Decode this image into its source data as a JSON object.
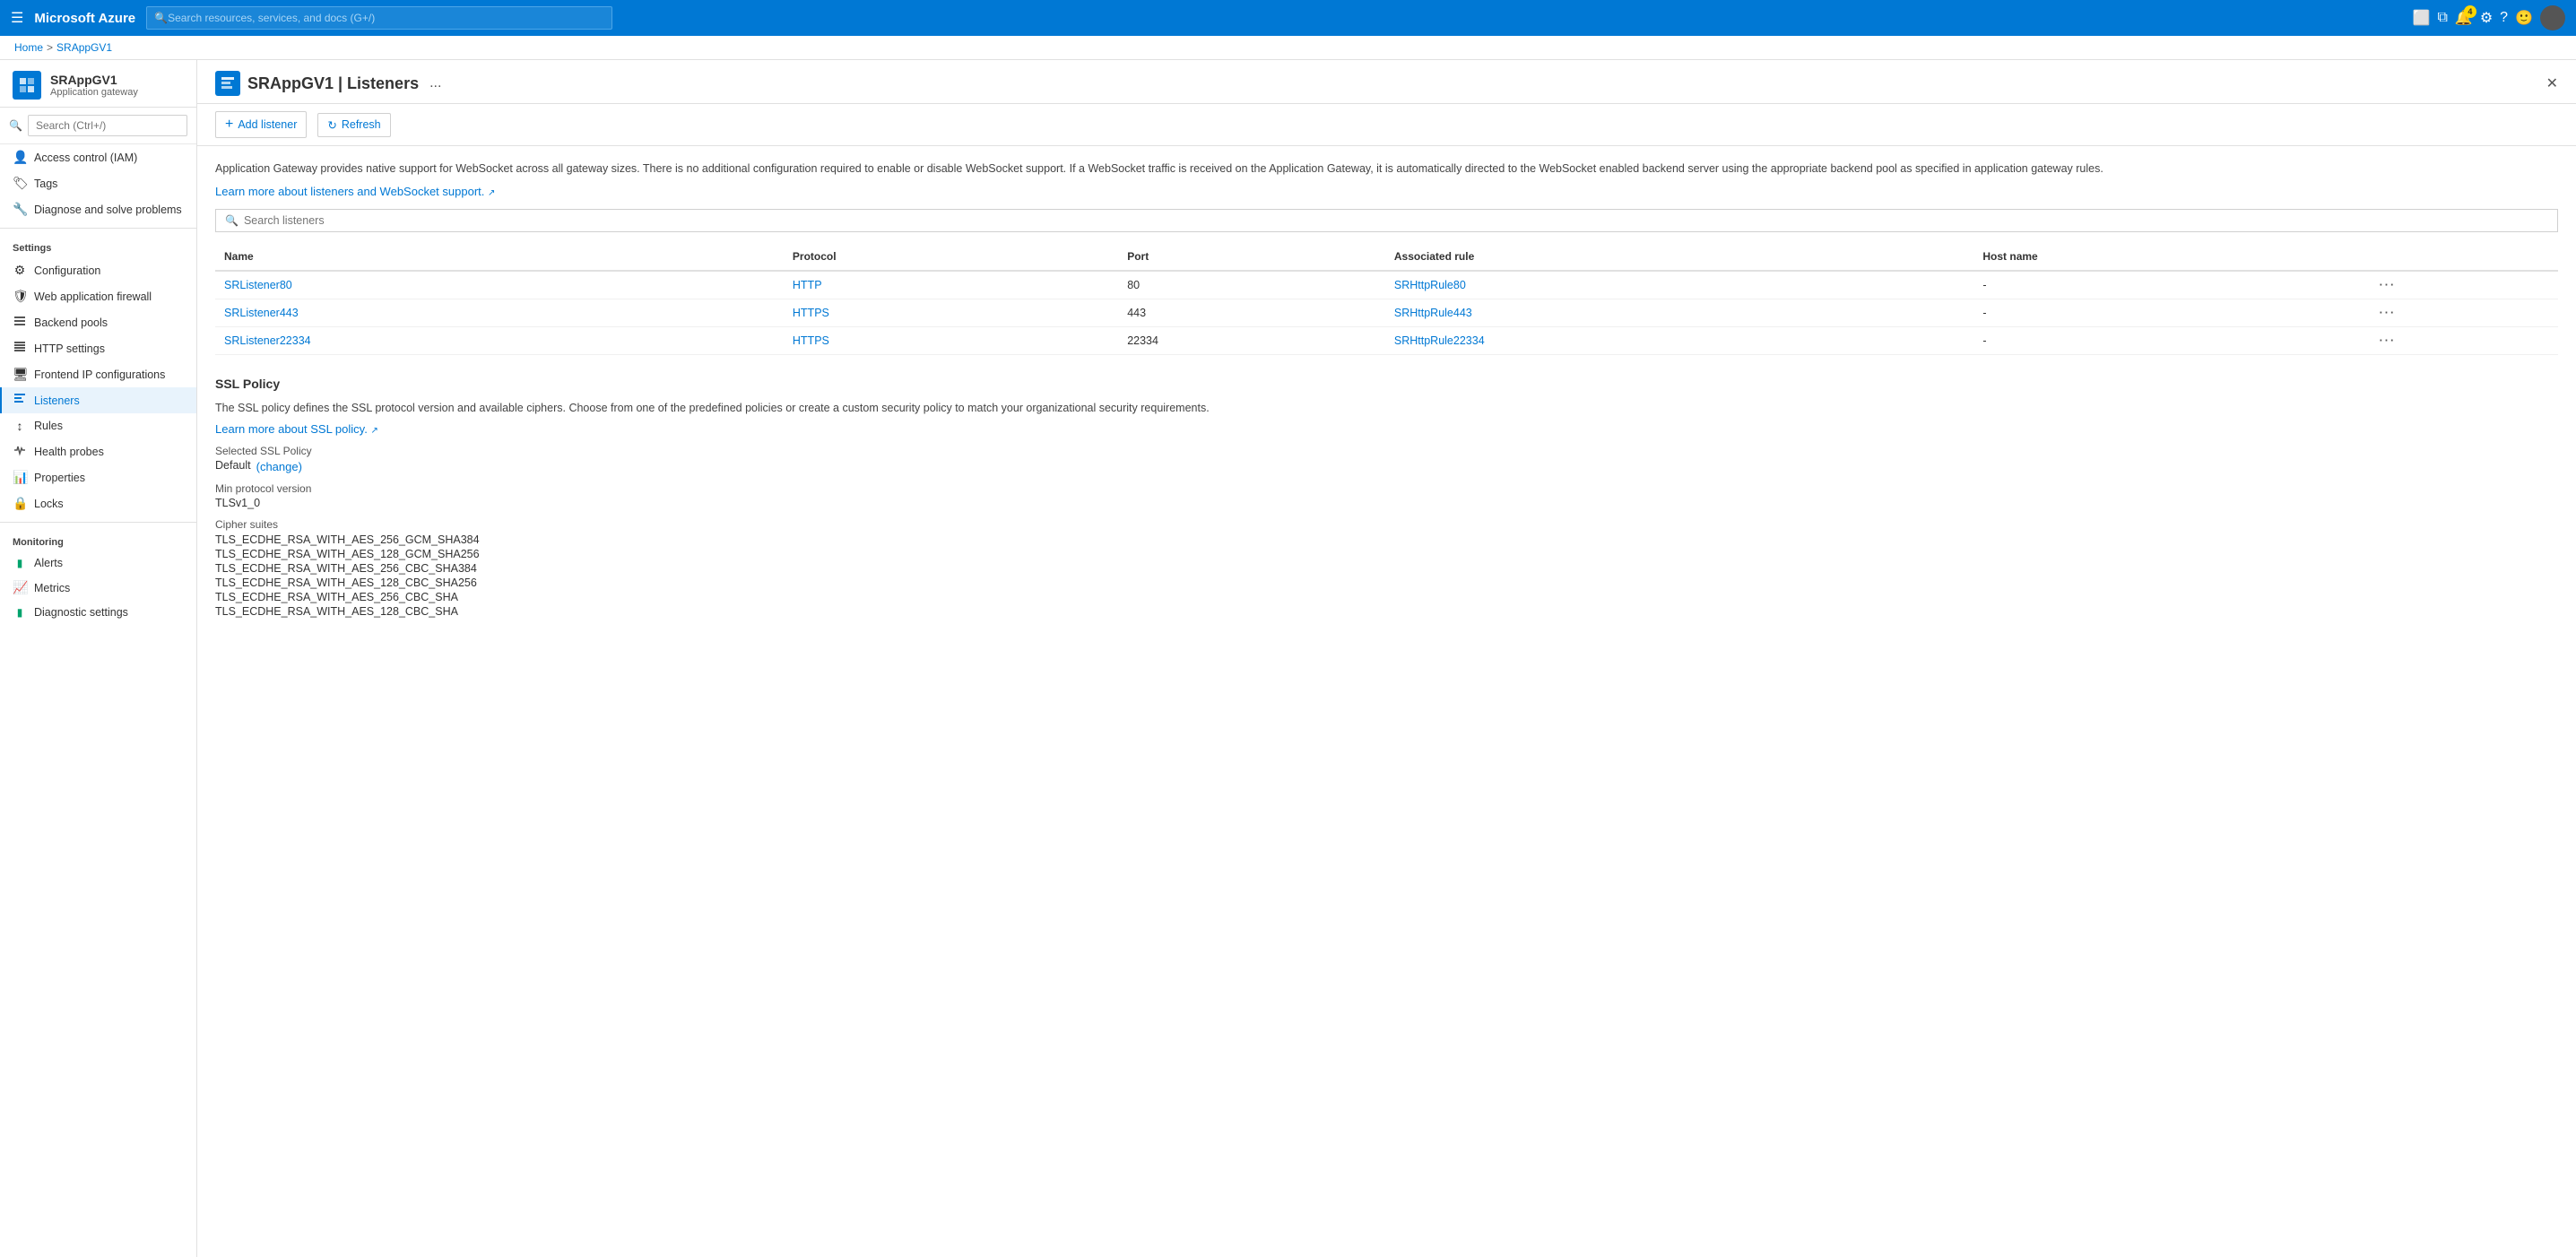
{
  "topbar": {
    "brand": "Microsoft Azure",
    "search_placeholder": "Search resources, services, and docs (G+/)",
    "notification_count": "4"
  },
  "breadcrumb": {
    "home": "Home",
    "resource": "SRAppGV1"
  },
  "sidebar": {
    "resource_title": "SRAppGV1 | Listeners",
    "resource_subtitle": "Application gateway",
    "search_placeholder": "Search (Ctrl+/)",
    "items_top": [
      {
        "id": "access-control",
        "label": "Access control (IAM)",
        "icon": "👤"
      },
      {
        "id": "tags",
        "label": "Tags",
        "icon": "🏷"
      },
      {
        "id": "diagnose",
        "label": "Diagnose and solve problems",
        "icon": "🔧"
      }
    ],
    "settings_label": "Settings",
    "settings_items": [
      {
        "id": "configuration",
        "label": "Configuration",
        "icon": "⚙"
      },
      {
        "id": "waf",
        "label": "Web application firewall",
        "icon": "🛡"
      },
      {
        "id": "backend-pools",
        "label": "Backend pools",
        "icon": "☰"
      },
      {
        "id": "http-settings",
        "label": "HTTP settings",
        "icon": "≡"
      },
      {
        "id": "frontend-ip",
        "label": "Frontend IP configurations",
        "icon": "🖥"
      },
      {
        "id": "listeners",
        "label": "Listeners",
        "icon": "≣",
        "active": true
      },
      {
        "id": "rules",
        "label": "Rules",
        "icon": "↕"
      },
      {
        "id": "health-probes",
        "label": "Health probes",
        "icon": "❤"
      },
      {
        "id": "properties",
        "label": "Properties",
        "icon": "📊"
      },
      {
        "id": "locks",
        "label": "Locks",
        "icon": "🔒"
      }
    ],
    "monitoring_label": "Monitoring",
    "monitoring_items": [
      {
        "id": "alerts",
        "label": "Alerts",
        "icon": "🟩"
      },
      {
        "id": "metrics",
        "label": "Metrics",
        "icon": "📈"
      },
      {
        "id": "diagnostic-settings",
        "label": "Diagnostic settings",
        "icon": "🟩"
      }
    ]
  },
  "page": {
    "title": "SRAppGV1 | Listeners",
    "subtitle": "Application gateway",
    "more_label": "...",
    "toolbar": {
      "add_label": "Add listener",
      "refresh_label": "Refresh"
    },
    "info_text": "Application Gateway provides native support for WebSocket across all gateway sizes. There is no additional configuration required to enable or disable WebSocket support. If a WebSocket traffic is received on the Application Gateway, it is automatically directed to the WebSocket enabled backend server using the appropriate backend pool as specified in application gateway rules.",
    "info_link": "Learn more about listeners and WebSocket support.",
    "search_placeholder": "Search listeners",
    "table": {
      "columns": [
        "Name",
        "Protocol",
        "Port",
        "Associated rule",
        "Host name"
      ],
      "rows": [
        {
          "name": "SRListener80",
          "protocol": "HTTP",
          "port": "80",
          "rule": "SRHttpRule80",
          "hostname": "-"
        },
        {
          "name": "SRListener443",
          "protocol": "HTTPS",
          "port": "443",
          "rule": "SRHttpRule443",
          "hostname": "-"
        },
        {
          "name": "SRListener22334",
          "protocol": "HTTPS",
          "port": "22334",
          "rule": "SRHttpRule22334",
          "hostname": "-"
        }
      ]
    },
    "ssl_policy": {
      "title": "SSL Policy",
      "desc": "The SSL policy defines the SSL protocol version and available ciphers. Choose from one of the predefined policies or create a custom security policy to match your organizational security requirements.",
      "link": "Learn more about SSL policy.",
      "selected_label": "Selected SSL Policy",
      "selected_value": "Default",
      "change_label": "(change)",
      "min_proto_label": "Min protocol version",
      "min_proto_value": "TLSv1_0",
      "cipher_suites_label": "Cipher suites",
      "cipher_suites": [
        "TLS_ECDHE_RSA_WITH_AES_256_GCM_SHA384",
        "TLS_ECDHE_RSA_WITH_AES_128_GCM_SHA256",
        "TLS_ECDHE_RSA_WITH_AES_256_CBC_SHA384",
        "TLS_ECDHE_RSA_WITH_AES_128_CBC_SHA256",
        "TLS_ECDHE_RSA_WITH_AES_256_CBC_SHA",
        "TLS_ECDHE_RSA_WITH_AES_128_CBC_SHA"
      ]
    }
  }
}
